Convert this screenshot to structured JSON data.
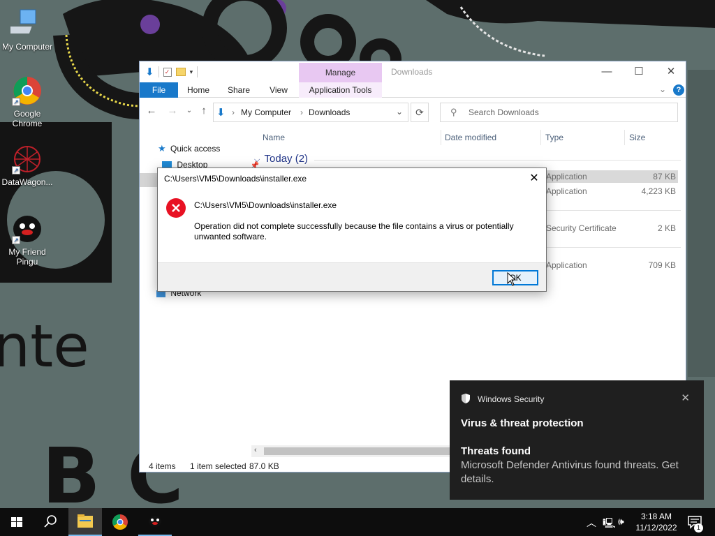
{
  "desktop": {
    "icons": [
      {
        "label": "My Computer"
      },
      {
        "label": "Google Chrome"
      },
      {
        "label": "DataWagon..."
      },
      {
        "label": "My Friend Pingu"
      }
    ]
  },
  "explorer": {
    "title": "Downloads",
    "manage_label": "Manage",
    "tabs": [
      "File",
      "Home",
      "Share",
      "View",
      "Application Tools"
    ],
    "breadcrumb": [
      "My Computer",
      "Downloads"
    ],
    "search_placeholder": "Search Downloads",
    "columns": [
      "Name",
      "Date modified",
      "Type",
      "Size"
    ],
    "nav": {
      "quick_access": "Quick access",
      "desktop": "Desktop",
      "network": "Network"
    },
    "group_label": "Today (2)",
    "rows": [
      {
        "type": "Application",
        "size": "87 KB"
      },
      {
        "type": "Application",
        "size": "4,223 KB"
      },
      {
        "type": "Security Certificate",
        "size": "2 KB"
      },
      {
        "type": "Application",
        "size": "709 KB"
      }
    ],
    "status": {
      "items": "4 items",
      "selected": "1 item selected",
      "size": "87.0 KB"
    }
  },
  "dialog": {
    "title": "C:\\Users\\VM5\\Downloads\\installer.exe",
    "path": "C:\\Users\\VM5\\Downloads\\installer.exe",
    "message": "Operation did not complete successfully because the file contains a virus or potentially unwanted software.",
    "ok_label": "OK"
  },
  "toast": {
    "app": "Windows Security",
    "heading": "Virus & threat protection",
    "subheading": "Threats found",
    "body": "Microsoft Defender Antivirus found threats. Get details."
  },
  "taskbar": {
    "time": "3:18 AM",
    "date": "11/12/2022",
    "notification_count": "1"
  },
  "colors": {
    "accent": "#1979ca",
    "manage_tab": "#e8c8f2",
    "error_red": "#e81123",
    "toast_bg": "#1f1f1f",
    "taskbar_bg": "#0d0d0d"
  }
}
